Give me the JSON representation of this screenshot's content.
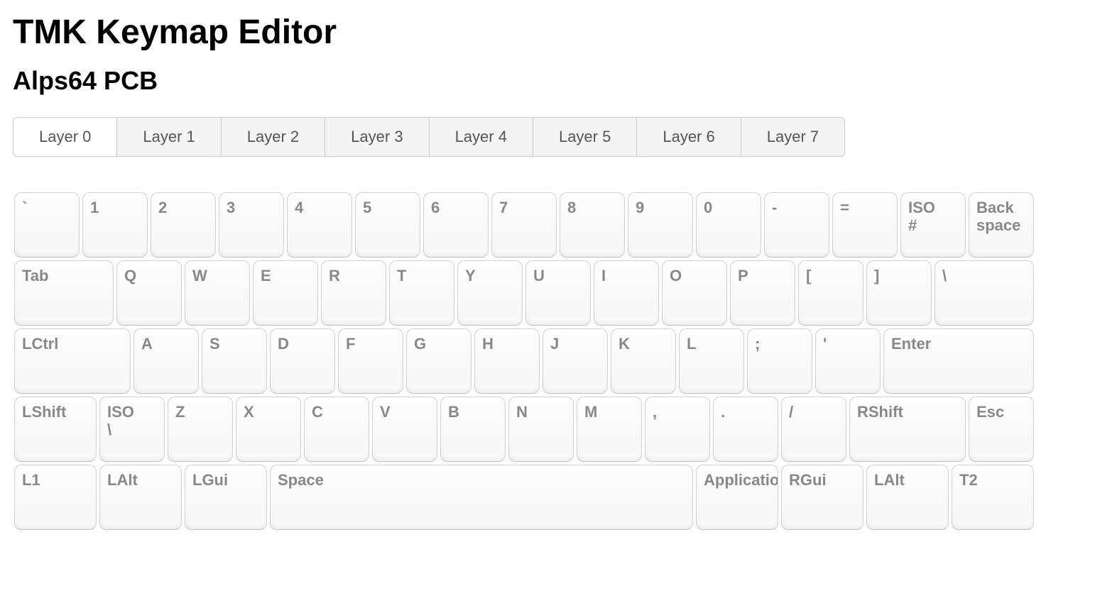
{
  "title": "TMK Keymap Editor",
  "subtitle": "Alps64 PCB",
  "tabs": [
    {
      "label": "Layer 0",
      "active": true
    },
    {
      "label": "Layer 1",
      "active": false
    },
    {
      "label": "Layer 2",
      "active": false
    },
    {
      "label": "Layer 3",
      "active": false
    },
    {
      "label": "Layer 4",
      "active": false
    },
    {
      "label": "Layer 5",
      "active": false
    },
    {
      "label": "Layer 6",
      "active": false
    },
    {
      "label": "Layer 7",
      "active": false
    }
  ],
  "unit": 96,
  "gap": 2,
  "rows": [
    [
      {
        "label": "`",
        "x": 0,
        "w": 1
      },
      {
        "label": "1",
        "x": 1,
        "w": 1
      },
      {
        "label": "2",
        "x": 2,
        "w": 1
      },
      {
        "label": "3",
        "x": 3,
        "w": 1
      },
      {
        "label": "4",
        "x": 4,
        "w": 1
      },
      {
        "label": "5",
        "x": 5,
        "w": 1
      },
      {
        "label": "6",
        "x": 6,
        "w": 1
      },
      {
        "label": "7",
        "x": 7,
        "w": 1
      },
      {
        "label": "8",
        "x": 8,
        "w": 1
      },
      {
        "label": "9",
        "x": 9,
        "w": 1
      },
      {
        "label": "0",
        "x": 10,
        "w": 1
      },
      {
        "label": "-",
        "x": 11,
        "w": 1
      },
      {
        "label": "=",
        "x": 12,
        "w": 1
      },
      {
        "label": "ISO\n#",
        "x": 13,
        "w": 1
      },
      {
        "label": "Back\nspace",
        "x": 14,
        "w": 1
      }
    ],
    [
      {
        "label": "Tab",
        "x": 0,
        "w": 1.5
      },
      {
        "label": "Q",
        "x": 1.5,
        "w": 1
      },
      {
        "label": "W",
        "x": 2.5,
        "w": 1
      },
      {
        "label": "E",
        "x": 3.5,
        "w": 1
      },
      {
        "label": "R",
        "x": 4.5,
        "w": 1
      },
      {
        "label": "T",
        "x": 5.5,
        "w": 1
      },
      {
        "label": "Y",
        "x": 6.5,
        "w": 1
      },
      {
        "label": "U",
        "x": 7.5,
        "w": 1
      },
      {
        "label": "I",
        "x": 8.5,
        "w": 1
      },
      {
        "label": "O",
        "x": 9.5,
        "w": 1
      },
      {
        "label": "P",
        "x": 10.5,
        "w": 1
      },
      {
        "label": "[",
        "x": 11.5,
        "w": 1
      },
      {
        "label": "]",
        "x": 12.5,
        "w": 1
      },
      {
        "label": "\\",
        "x": 13.5,
        "w": 1.5
      }
    ],
    [
      {
        "label": "LCtrl",
        "x": 0,
        "w": 1.75
      },
      {
        "label": "A",
        "x": 1.75,
        "w": 1
      },
      {
        "label": "S",
        "x": 2.75,
        "w": 1
      },
      {
        "label": "D",
        "x": 3.75,
        "w": 1
      },
      {
        "label": "F",
        "x": 4.75,
        "w": 1
      },
      {
        "label": "G",
        "x": 5.75,
        "w": 1
      },
      {
        "label": "H",
        "x": 6.75,
        "w": 1
      },
      {
        "label": "J",
        "x": 7.75,
        "w": 1
      },
      {
        "label": "K",
        "x": 8.75,
        "w": 1
      },
      {
        "label": "L",
        "x": 9.75,
        "w": 1
      },
      {
        "label": ";",
        "x": 10.75,
        "w": 1
      },
      {
        "label": "'",
        "x": 11.75,
        "w": 1
      },
      {
        "label": "Enter",
        "x": 12.75,
        "w": 2.25
      }
    ],
    [
      {
        "label": "LShift",
        "x": 0,
        "w": 1.25
      },
      {
        "label": "ISO\n\\",
        "x": 1.25,
        "w": 1
      },
      {
        "label": "Z",
        "x": 2.25,
        "w": 1
      },
      {
        "label": "X",
        "x": 3.25,
        "w": 1
      },
      {
        "label": "C",
        "x": 4.25,
        "w": 1
      },
      {
        "label": "V",
        "x": 5.25,
        "w": 1
      },
      {
        "label": "B",
        "x": 6.25,
        "w": 1
      },
      {
        "label": "N",
        "x": 7.25,
        "w": 1
      },
      {
        "label": "M",
        "x": 8.25,
        "w": 1
      },
      {
        "label": ",",
        "x": 9.25,
        "w": 1
      },
      {
        "label": ".",
        "x": 10.25,
        "w": 1
      },
      {
        "label": "/",
        "x": 11.25,
        "w": 1
      },
      {
        "label": "RShift",
        "x": 12.25,
        "w": 1.75
      },
      {
        "label": "Esc",
        "x": 14,
        "w": 1
      }
    ],
    [
      {
        "label": "L1",
        "x": 0,
        "w": 1.25
      },
      {
        "label": "LAlt",
        "x": 1.25,
        "w": 1.25
      },
      {
        "label": "LGui",
        "x": 2.5,
        "w": 1.25
      },
      {
        "label": "Space",
        "x": 3.75,
        "w": 6.25
      },
      {
        "label": "Application",
        "x": 10,
        "w": 1.25
      },
      {
        "label": "RGui",
        "x": 11.25,
        "w": 1.25
      },
      {
        "label": "LAlt",
        "x": 12.5,
        "w": 1.25
      },
      {
        "label": "T2",
        "x": 13.75,
        "w": 1.25
      }
    ]
  ]
}
